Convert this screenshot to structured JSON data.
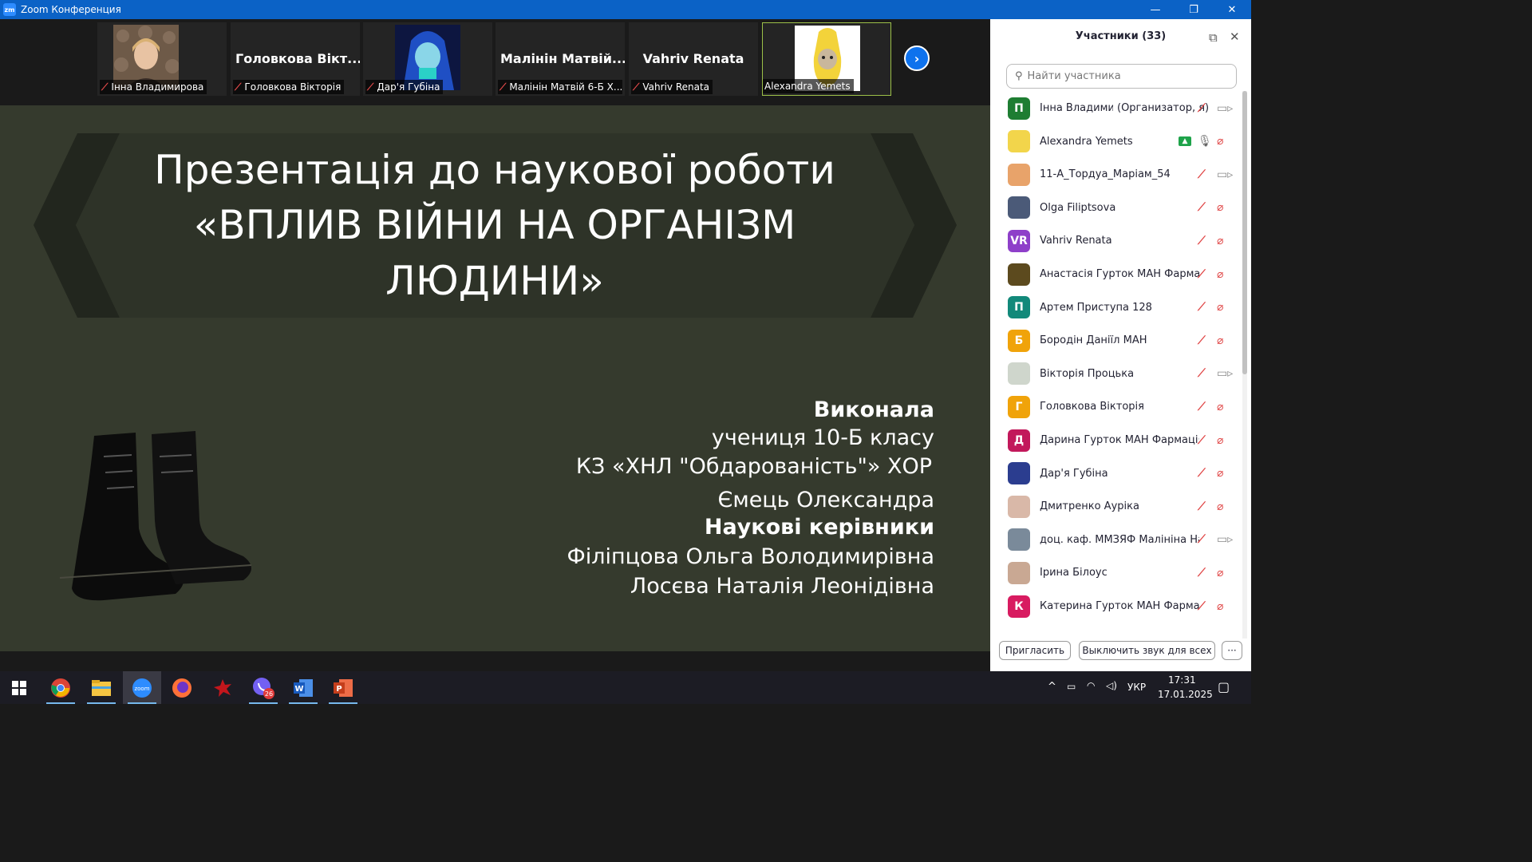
{
  "window": {
    "logo_text": "zm",
    "title": "Zoom Конференция",
    "controls": {
      "minimize": "—",
      "restore": "❐",
      "close": "✕"
    }
  },
  "thumbnails": [
    {
      "name": "Інна Владимирова",
      "big_name": "",
      "muted": true,
      "active": false
    },
    {
      "name": "Головкова Вікторія",
      "big_name": "Головкова Вікт...",
      "muted": true,
      "active": false
    },
    {
      "name": "Дар'я Губіна",
      "big_name": "",
      "muted": true,
      "active": false
    },
    {
      "name": "Малінін Матвій 6-Б Х...",
      "big_name": "Малінін Матвій...",
      "muted": true,
      "active": false
    },
    {
      "name": "Vahriv Renata",
      "big_name": "Vahriv Renata",
      "muted": true,
      "active": false
    },
    {
      "name": "Alexandra Yemets",
      "big_name": "",
      "muted": false,
      "active": true
    }
  ],
  "next_page_icon": "chevron-right",
  "slide": {
    "title_lines": [
      "Презентація до наукової роботи",
      "«ВПЛИВ ВІЙНИ НА ОРГАНІЗМ",
      "ЛЮДИНИ»"
    ],
    "author_heading": "Виконала",
    "author_lines": [
      "учениця 10-Б класу",
      "КЗ «ХНЛ \"Обдарованість\"» ХОР",
      "Ємець Олександра"
    ],
    "supervisors_heading": "Наукові керівники",
    "supervisor_lines": [
      "Філіпцова Ольга Володимирівна",
      "Лосєва Наталія Леонідівна"
    ],
    "colors": {
      "background": "#353a2d",
      "banner": "#2e3328",
      "chevron": "#22261e"
    }
  },
  "panel": {
    "title": "Участники (33)",
    "search_placeholder": "Найти участника",
    "participants": [
      {
        "name": "Інна Владими...",
        "role": "(Организатор, я)",
        "avatar_letter": "П",
        "avatar_color": "#1e7d32",
        "mic": "off",
        "cam": "on",
        "sharing": false
      },
      {
        "name": "Alexandra Yemets",
        "role": "",
        "avatar_letter": "",
        "avatar_color": "#f2d54b",
        "mic": "on",
        "cam": "off",
        "sharing": true
      },
      {
        "name": "11-А_Тордуа_Маріам_54",
        "role": "",
        "avatar_letter": "",
        "avatar_color": "#e8a36a",
        "mic": "off",
        "cam": "on",
        "sharing": false
      },
      {
        "name": "Olga Filiptsova",
        "role": "",
        "avatar_letter": "",
        "avatar_color": "#4b5a78",
        "mic": "off",
        "cam": "off",
        "sharing": false
      },
      {
        "name": "Vahriv Renata",
        "role": "",
        "avatar_letter": "VR",
        "avatar_color": "#8e3fc9",
        "mic": "off",
        "cam": "off",
        "sharing": false
      },
      {
        "name": "Анастасія Гурток МАН Фармація",
        "role": "",
        "avatar_letter": "",
        "avatar_color": "#5c4a1e",
        "mic": "off",
        "cam": "off",
        "sharing": false
      },
      {
        "name": "Артем Приступа 128",
        "role": "",
        "avatar_letter": "П",
        "avatar_color": "#12897a",
        "mic": "off",
        "cam": "off",
        "sharing": false
      },
      {
        "name": "Бородін Даніїл МАН",
        "role": "",
        "avatar_letter": "Б",
        "avatar_color": "#f0a30a",
        "mic": "off",
        "cam": "off",
        "sharing": false
      },
      {
        "name": "Вікторія Процька",
        "role": "",
        "avatar_letter": "",
        "avatar_color": "#cfd6cc",
        "mic": "off",
        "cam": "on",
        "sharing": false
      },
      {
        "name": "Головкова Вікторія",
        "role": "",
        "avatar_letter": "Г",
        "avatar_color": "#f0a30a",
        "mic": "off",
        "cam": "off",
        "sharing": false
      },
      {
        "name": "Дарина Гурток МАН Фармація",
        "role": "",
        "avatar_letter": "Д",
        "avatar_color": "#c2185b",
        "mic": "off",
        "cam": "off",
        "sharing": false
      },
      {
        "name": "Дар'я Губіна",
        "role": "",
        "avatar_letter": "",
        "avatar_color": "#2b3d8f",
        "mic": "off",
        "cam": "off",
        "sharing": false
      },
      {
        "name": "Дмитренко Аурікa",
        "role": "",
        "avatar_letter": "",
        "avatar_color": "#d9b8a8",
        "mic": "off",
        "cam": "off",
        "sharing": false
      },
      {
        "name": "доц. каф. ММЗЯФ Малініна Нат...",
        "role": "",
        "avatar_letter": "",
        "avatar_color": "#7a8a9a",
        "mic": "off",
        "cam": "on",
        "sharing": false
      },
      {
        "name": "Ірина Білоус",
        "role": "",
        "avatar_letter": "",
        "avatar_color": "#c9a893",
        "mic": "off",
        "cam": "off",
        "sharing": false
      },
      {
        "name": "Катерина Гурток МАН Фармація",
        "role": "",
        "avatar_letter": "К",
        "avatar_color": "#d81b60",
        "mic": "off",
        "cam": "off",
        "sharing": false
      }
    ],
    "footer": {
      "invite": "Пригласить",
      "mute_all": "Выключить звук для всех",
      "more": "···"
    }
  },
  "taskbar": {
    "apps": [
      "windows-start",
      "chrome",
      "file-explorer",
      "zoom",
      "firefox",
      "red-app",
      "viber",
      "word",
      "powerpoint"
    ],
    "viber_badge": "26",
    "language": "УКР",
    "time": "17:31",
    "date": "17.01.2025"
  }
}
